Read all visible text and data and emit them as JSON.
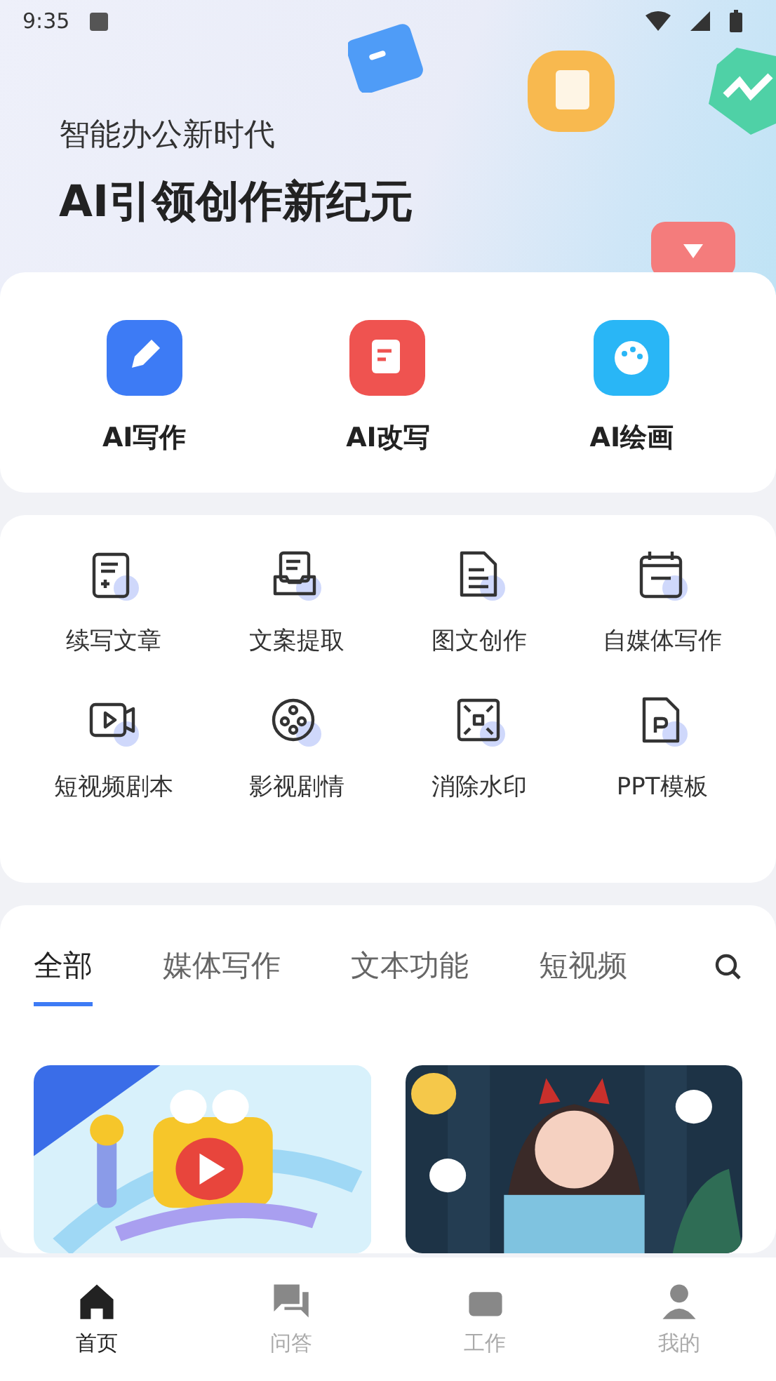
{
  "status_bar": {
    "time": "9:35"
  },
  "banner": {
    "subtitle": "智能办公新时代",
    "title": "AI引领创作新纪元"
  },
  "main_tools": [
    {
      "label": "AI写作",
      "color": "#3d7bf5"
    },
    {
      "label": "AI改写",
      "color": "#ef5350"
    },
    {
      "label": "AI绘画",
      "color": "#29b6f6"
    }
  ],
  "tools": [
    {
      "label": "续写文章"
    },
    {
      "label": "文案提取"
    },
    {
      "label": "图文创作"
    },
    {
      "label": "自媒体写作"
    },
    {
      "label": "短视频剧本"
    },
    {
      "label": "影视剧情"
    },
    {
      "label": "消除水印"
    },
    {
      "label": "PPT模板"
    }
  ],
  "tabs": [
    {
      "label": "全部",
      "selected": true
    },
    {
      "label": "媒体写作",
      "selected": false
    },
    {
      "label": "文本功能",
      "selected": false
    },
    {
      "label": "短视频",
      "selected": false
    }
  ],
  "bottom_nav": [
    {
      "label": "首页",
      "selected": true
    },
    {
      "label": "问答",
      "selected": false
    },
    {
      "label": "工作",
      "selected": false
    },
    {
      "label": "我的",
      "selected": false
    }
  ]
}
